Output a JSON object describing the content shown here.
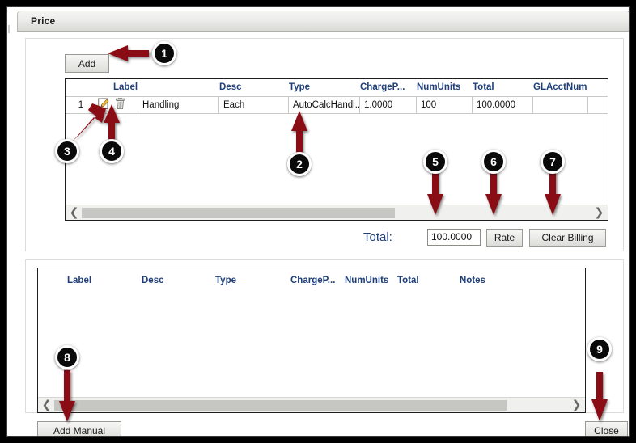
{
  "window": {
    "title": "Price"
  },
  "toolbar": {
    "add_label": "Add"
  },
  "upper_grid": {
    "columns": [
      "Label",
      "Desc",
      "Type",
      "ChargeP...",
      "NumUnits",
      "Total",
      "GLAcctNum"
    ],
    "rows": [
      {
        "num": "1",
        "edit_icon": "pencil-edit-icon",
        "delete_icon": "trash-delete-icon",
        "Label": "Handling",
        "Desc": "Each",
        "Type": "AutoCalcHandl...",
        "ChargeP": "1.0000",
        "NumUnits": "100",
        "Total": "100.0000",
        "GLAcctNum": ""
      }
    ],
    "scroll_left_icon": "chevron-left-icon",
    "scroll_right_icon": "chevron-right-icon"
  },
  "totals": {
    "label": "Total:",
    "value": "100.0000",
    "rate_label": "Rate",
    "clear_billing_label": "Clear Billing"
  },
  "lower_grid": {
    "columns": [
      "Label",
      "Desc",
      "Type",
      "ChargeP...",
      "NumUnits",
      "Total",
      "Notes"
    ],
    "rows": [],
    "scroll_left_icon": "chevron-left-icon",
    "scroll_right_icon": "chevron-right-icon"
  },
  "footer": {
    "add_manual_label": "Add Manual",
    "close_label": "Close"
  },
  "annotations": {
    "accent_color": "#8a1117",
    "badges": [
      {
        "n": "1",
        "target": "add-button"
      },
      {
        "n": "2",
        "target": "type-cell"
      },
      {
        "n": "3",
        "target": "edit-icon"
      },
      {
        "n": "4",
        "target": "delete-icon"
      },
      {
        "n": "5",
        "target": "total-value"
      },
      {
        "n": "6",
        "target": "rate-button"
      },
      {
        "n": "7",
        "target": "clear-billing-button"
      },
      {
        "n": "8",
        "target": "add-manual-button"
      },
      {
        "n": "9",
        "target": "close-button"
      }
    ]
  }
}
